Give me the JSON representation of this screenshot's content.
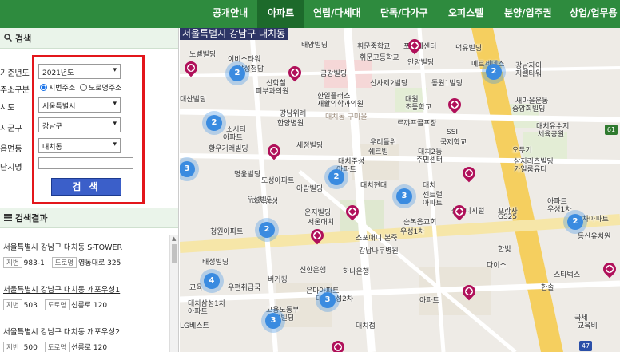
{
  "nav": {
    "items": [
      "공개안내",
      "아파트",
      "연립/다세대",
      "단독/다가구",
      "오피스텔",
      "분양/입주권",
      "상업/업무용"
    ],
    "active": "아파트"
  },
  "search": {
    "header": "검색",
    "year_label": "기준년도",
    "year_value": "2021년도",
    "addr_type_label": "주소구분",
    "addr_opt1": "지번주소",
    "addr_opt2": "도로명주소",
    "sido_label": "시도",
    "sido_value": "서울특별시",
    "sigungu_label": "시군구",
    "sigungu_value": "강남구",
    "dong_label": "읍면동",
    "dong_value": "대치동",
    "complex_label": "단지명",
    "complex_value": "",
    "button": "검 색"
  },
  "results": {
    "header": "검색결과",
    "jibun_tag": "지번",
    "road_tag": "도로명",
    "items": [
      {
        "title": "서울특별시 강남구 대치동 S-TOWER",
        "jibun": "983-1",
        "road": "영동대로 325"
      },
      {
        "title": "서울특별시 강남구 대치동 개포우성1",
        "jibun": "503",
        "road": "선릉로 120"
      },
      {
        "title": "서울특별시 강남구 대치동 개포우성2",
        "jibun": "500",
        "road": "선릉로 120"
      }
    ]
  },
  "map": {
    "address": "서울특별시 강남구 대치동",
    "labels": [
      "노벨빌딩",
      "이비스타워",
      "삼성청담",
      "태양빌딩",
      "휘문중학교",
      "포르쉐센터",
      "덕유빌딩",
      "메르세데스",
      "강남자이",
      "지웰타워",
      "휘문고등학교",
      "안양빌딩",
      "도곡 방어",
      "대산빌딩",
      "신학철",
      "피부과의원",
      "금강빌딩",
      "신사제2빌딩",
      "동원1빌딩",
      "한일플러스",
      "재활의학과의원",
      "대원",
      "초등학교",
      "새마을운동",
      "중앙회빌딩",
      "강남위례",
      "한양병원",
      "대치동 구마을",
      "르꺄프골프장",
      "SSI",
      "국제학교",
      "대치유수지",
      "체육공원",
      "소시티",
      "아파트",
      "황우거래빌딩",
      "세정빌딩",
      "우리들위",
      "쉐르빌",
      "대치2동",
      "주민센터",
      "오두기",
      "삼지리츠빌딩",
      "카일룸유디",
      "명윤빌딩",
      "대치주성",
      "아파트",
      "도성아파트",
      "아람빌딩",
      "대치",
      "센트럴",
      "아파트",
      "대치현대",
      "대치삼성",
      "대치",
      "청소년",
      "삼성디지털",
      "프라자",
      "GS25",
      "우성빌딩",
      "운지빌딩",
      "서울대치",
      "순복음교회",
      "우성1차",
      "아파트",
      "우성1차",
      "2차아파트",
      "동산유치원",
      "청원아파트",
      "태성빌딩",
      "스포애니 본죽",
      "강남나무병원",
      "한빛",
      "다이소",
      "버거킹",
      "신한은행",
      "하나은행",
      "스타벅스",
      "한솔",
      "교육",
      "빌딩",
      "서울대치4동",
      "우편취급국",
      "대치삼성1차",
      "아파트",
      "은마아파트",
      "대치삼성2차",
      "아파트",
      "고용노동부",
      "해성빌딩",
      "LG베스트",
      "대치점",
      "국세",
      "교육비"
    ],
    "clusters": [
      2,
      2,
      3,
      2,
      3,
      2,
      4,
      2,
      3,
      3,
      2
    ],
    "route_number": "61",
    "route_number2": "47"
  }
}
